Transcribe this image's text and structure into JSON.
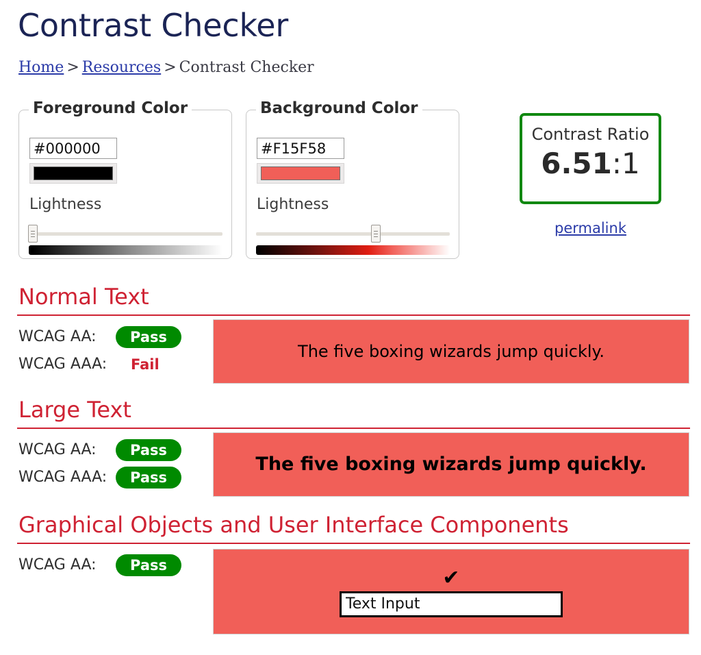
{
  "header": {
    "title": "Contrast Checker",
    "breadcrumb": {
      "home": "Home",
      "separator_1": ">",
      "resources": "Resources",
      "separator_2": ">",
      "current": "Contrast Checker"
    }
  },
  "colors": {
    "foreground_hex": "#000000",
    "background_hex": "#F15F58",
    "accent_red": "#CF2233",
    "pass_green": "#008A00",
    "ratio_border_green": "#118811",
    "link_blue": "#2B3BA8",
    "title_navy": "#1B2455"
  },
  "foreground_panel": {
    "legend": "Foreground Color",
    "hex_value": "#000000",
    "hex_placeholder": "#000000",
    "lightness_label": "Lightness",
    "lightness_percent": 2
  },
  "background_panel": {
    "legend": "Background Color",
    "hex_value": "#F15F58",
    "hex_placeholder": "#000000",
    "lightness_label": "Lightness",
    "lightness_percent": 62
  },
  "ratio_panel": {
    "title": "Contrast Ratio",
    "value": "6.51",
    "suffix": ":1",
    "permalink_label": "permalink"
  },
  "sections": [
    {
      "heading": "Normal Text",
      "criteria": [
        {
          "label": "WCAG AA:",
          "verdict": "Pass",
          "state": "pass"
        },
        {
          "label": "WCAG AAA:",
          "verdict": "Fail",
          "state": "fail"
        }
      ],
      "sample_text": "The five boxing wizards jump quickly."
    },
    {
      "heading": "Large Text",
      "criteria": [
        {
          "label": "WCAG AA:",
          "verdict": "Pass",
          "state": "pass"
        },
        {
          "label": "WCAG AAA:",
          "verdict": "Pass",
          "state": "pass"
        }
      ],
      "sample_text": "The five boxing wizards jump quickly."
    },
    {
      "heading": "Graphical Objects and User Interface Components",
      "criteria": [
        {
          "label": "WCAG AA:",
          "verdict": "Pass",
          "state": "pass"
        }
      ],
      "check_glyph": "✔",
      "input_value": "Text Input"
    }
  ]
}
